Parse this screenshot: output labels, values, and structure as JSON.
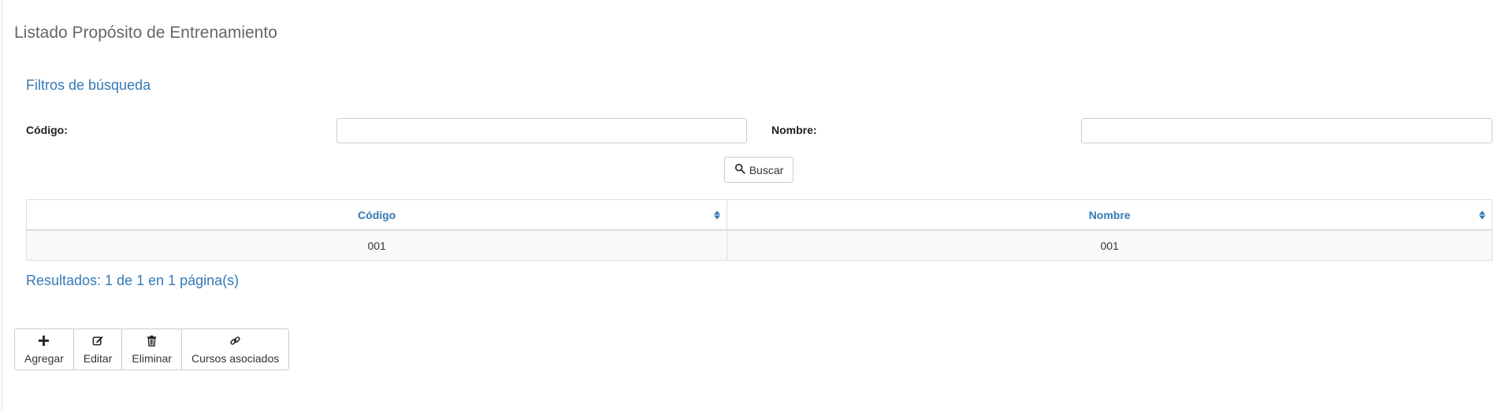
{
  "page": {
    "title": "Listado Propósito de Entrenamiento"
  },
  "filters": {
    "title": "Filtros de búsqueda",
    "codigo_label": "Código:",
    "codigo_value": "",
    "nombre_label": "Nombre:",
    "nombre_value": "",
    "search_button": "Buscar"
  },
  "table": {
    "columns": [
      "Código",
      "Nombre"
    ],
    "rows": [
      [
        "001",
        "001"
      ]
    ]
  },
  "results": {
    "text": "Resultados: 1 de 1 en 1 página(s)"
  },
  "toolbar": {
    "add": "Agregar",
    "edit": "Editar",
    "delete": "Eliminar",
    "courses": "Cursos asociados"
  },
  "colors": {
    "accent": "#337ab7",
    "border": "#cccccc",
    "row_bg": "#f9f9f9"
  }
}
